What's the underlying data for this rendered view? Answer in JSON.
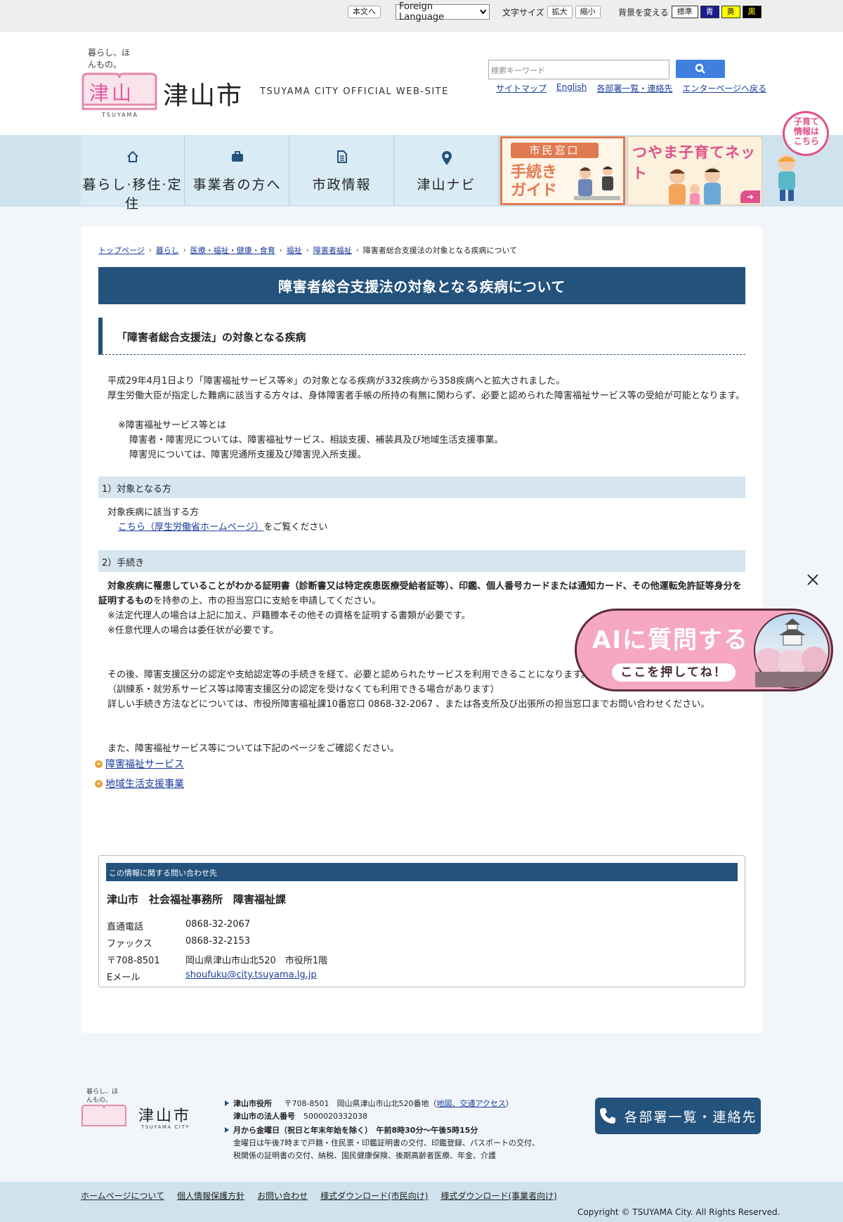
{
  "topbar": {
    "skip_label": "本文へ",
    "language_label": "Foreign Language",
    "font_size_label": "文字サイズ",
    "enlarge_label": "拡大",
    "shrink_label": "縮小",
    "bg_label": "背景を変える",
    "bg_standard": "標準",
    "bg_blue": "青",
    "bg_yellow": "黄",
    "bg_black": "黒"
  },
  "header": {
    "logo_tagline": "暮らし、ほんもの。",
    "logo_city_kanji": "津山",
    "logo_romaji": "TSUYAMA",
    "title": "津山市",
    "subtitle": "TSUYAMA CITY OFFICIAL WEB-SITE",
    "search_placeholder": "検索キーワード",
    "links": [
      "サイトマップ",
      "English",
      "各部署一覧・連絡先",
      "エンターページへ戻る"
    ]
  },
  "nav": {
    "items": [
      {
        "label": "暮らし·移住·定住",
        "icon": "home-icon"
      },
      {
        "label": "事業者の方へ",
        "icon": "briefcase-icon"
      },
      {
        "label": "市政情報",
        "icon": "document-icon"
      },
      {
        "label": "津山ナビ",
        "icon": "map-pin-icon"
      }
    ],
    "banner1_top": "市民窓口",
    "banner1_main": "手続き\nガイド",
    "banner2_main": "つやま子育てネット",
    "kosodate_text": "子育て\n情報は\nこちら"
  },
  "breadcrumb": [
    "トップページ",
    "暮らし",
    "医療・福祉・健康・食育",
    "福祉",
    "障害者福祉",
    "障害者総合支援法の対象となる疾病について"
  ],
  "page": {
    "title": "障害者総合支援法の対象となる疾病について",
    "section_heading": "「障害者総合支援法」の対象となる疾病",
    "intro_1": "平成29年4月1日より「障害福祉サービス等※」の対象となる疾病が332疾病から358疾病へと拡大されました。",
    "intro_2": "厚生労働大臣が指定した難病に該当する方々は、身体障害者手帳の所持の有無に関わらず、必要と認められた障害福祉サービス等の受給が可能となります。",
    "note_title": "※障害福祉サービス等とは",
    "note_1": "障害者・障害児については、障害福祉サービス、相談支援、補装具及び地域生活支援事業。",
    "note_2": "障害児については、障害児通所支援及び障害児入所支援。",
    "h3_1": "1）対象となる方",
    "target_text": "対象疾病に該当する方",
    "target_link": "こちら（厚生労働省ホームページ）",
    "target_suffix": "をご覧ください",
    "h3_2": "2）手続き",
    "proc_bold": "対象疾病に罹患していることがわかる証明書（診断書又は特定疾患医療受給者証等）、印鑑、個人番号カードまたは通知カード、その他運転免許証等身分を証明するもの",
    "proc_rest": "を持参の上、市の担当窓口に支給を申請してください。",
    "proc_note1": "※法定代理人の場合は上記に加え、戸籍謄本その他その資格を証明する書類が必要です。",
    "proc_note2": "※任意代理人の場合は委任状が必要です。",
    "after_1": "その後、障害支援区分の認定や支給認定等の手続きを経て、必要と認められたサービスを利用できることになります。",
    "after_2": "（訓練系・就労系サービス等は障害支援区分の認定を受けなくても利用できる場合があります）",
    "after_3": "詳しい手続き方法などについては、市役所障害福祉課10番窓口 0868-32-2067 、または各支所及び出張所の担当窓口までお問い合わせください。",
    "also": "また、障害福祉サービス等については下記のページをご確認ください。",
    "links": [
      "障害福祉サービス",
      "地域生活支援事業"
    ]
  },
  "contact": {
    "heading": "この情報に関する問い合わせ先",
    "org": "津山市　社会福祉事務所　障害福祉課",
    "rows": [
      {
        "key": "直通電話",
        "value": "0868-32-2067"
      },
      {
        "key": "ファックス",
        "value": "0868-32-2153"
      },
      {
        "key": "〒708-8501",
        "value": "岡山県津山市山北520　市役所1階"
      },
      {
        "key": "Eメール",
        "value": "shoufuku@city.tsuyama.lg.jp"
      }
    ]
  },
  "ai_widget": {
    "title": "AIに質問する",
    "subtitle": "ここを押してね！"
  },
  "footer": {
    "logo_tagline": "暮らし、ほんもの。",
    "logo_city": "津山市",
    "logo_romaji": "TSUYAMA CITY",
    "office_label": "津山市役所",
    "office_addr": "〒708‐8501　岡山県津山市山北520番地（",
    "office_link": "地図、交通アクセス",
    "office_close": "）",
    "corp_label": "津山市の法人番号",
    "corp_num": "5000020332038",
    "hours_label": "月から金曜日（祝日と年末年始を除く）　午前8時30分～午後5時15分",
    "hours_note_1": "金曜日は午後7時まで戸籍・住民票・印鑑証明書の交付、印鑑登録、パスポートの交付、",
    "hours_note_2": "税関係の証明書の交付、納税、国民健康保険、後期高齢者医療、年金、介護",
    "dept_button": "各部署一覧・連絡先",
    "bottom_links": [
      "ホームページについて",
      "個人情報保護方針",
      "お問い合わせ",
      "様式ダウンロード(市民向け)",
      "様式ダウンロード(事業者向け)"
    ],
    "copyright": "Copyright © TSUYAMA City. All Rights Reserved."
  },
  "colors": {
    "primary": "#23527c",
    "nav_bg": "#d9ebf5",
    "accent_pink": "#f6a7c2",
    "search_blue": "#3e7fe0"
  }
}
